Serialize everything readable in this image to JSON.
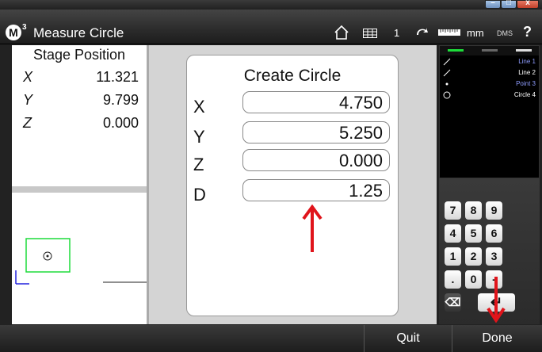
{
  "app": {
    "logo_letter": "M",
    "logo_sup": "3",
    "title": "Measure Circle",
    "feature_count": "1",
    "unit": "mm",
    "angle_format": "DMS",
    "help": "?",
    "window_controls": {
      "minimize": "–",
      "maximize": "□",
      "close": "x"
    }
  },
  "stage": {
    "title": "Stage Position",
    "axes": [
      {
        "axis": "X",
        "value": "11.321"
      },
      {
        "axis": "Y",
        "value": "9.799"
      },
      {
        "axis": "Z",
        "value": "0.000"
      }
    ]
  },
  "dialog": {
    "title": "Create Circle",
    "fields": [
      {
        "label": "X",
        "value": "4.750"
      },
      {
        "label": "Y",
        "value": "5.250"
      },
      {
        "label": "Z",
        "value": "0.000"
      },
      {
        "label": "D",
        "value": "1.25"
      }
    ]
  },
  "features": {
    "items": [
      {
        "icon": "line-icon",
        "label": "Line 1",
        "color": "#8f9dff"
      },
      {
        "icon": "line-icon",
        "label": "Line 2",
        "color": "#ffffff"
      },
      {
        "icon": "point-icon",
        "label": "Point 3",
        "color": "#8f9dff"
      },
      {
        "icon": "circle-icon",
        "label": "Circle 4",
        "color": "#ffffff"
      }
    ]
  },
  "keypad": {
    "keys": [
      "7",
      "8",
      "9",
      "4",
      "5",
      "6",
      "1",
      "2",
      "3",
      ".",
      "0",
      "-",
      "⌫",
      "↵"
    ]
  },
  "footer": {
    "quit": "Quit",
    "done": "Done"
  },
  "colors": {
    "accent_green": "#1ddc3a",
    "annotation_red": "#e0141b",
    "highlight_blue": "#8f9dff"
  }
}
